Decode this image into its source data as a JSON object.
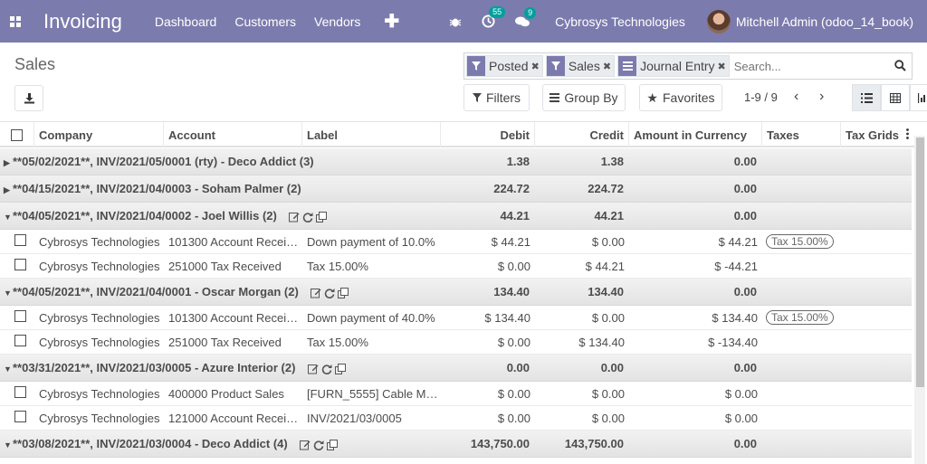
{
  "navbar": {
    "brand": "Invoicing",
    "menu": [
      "Dashboard",
      "Customers",
      "Vendors"
    ],
    "activity_count": "55",
    "message_count": "9",
    "company": "Cybrosys Technologies",
    "user": "Mitchell Admin (odoo_14_book)"
  },
  "control": {
    "breadcrumb": "Sales",
    "facets": [
      {
        "label": "Posted",
        "type": "filter"
      },
      {
        "label": "Sales",
        "type": "filter"
      },
      {
        "label": "Journal Entry",
        "type": "groupby"
      }
    ],
    "search_placeholder": "Search...",
    "filters_label": "Filters",
    "groupby_label": "Group By",
    "favorites_label": "Favorites",
    "pager": "1-9 / 9"
  },
  "table": {
    "columns": [
      "Company",
      "Account",
      "Label",
      "Debit",
      "Credit",
      "Amount in Currency",
      "Taxes",
      "Tax Grids"
    ],
    "rows": [
      {
        "kind": "group",
        "open": false,
        "label": "**05/02/2021**, INV/2021/05/0001 (rty) - Deco Addict (3)",
        "debit": "1.38",
        "credit": "1.38",
        "amount": "0.00"
      },
      {
        "kind": "group",
        "open": false,
        "label": "**04/15/2021**, INV/2021/04/0003 - Soham Palmer (2)",
        "debit": "224.72",
        "credit": "224.72",
        "amount": "0.00"
      },
      {
        "kind": "group",
        "open": true,
        "label": "**04/05/2021**, INV/2021/04/0002 - Joel Willis (2)",
        "debit": "44.21",
        "credit": "44.21",
        "amount": "0.00"
      },
      {
        "kind": "line",
        "company": "Cybrosys Technologies",
        "account": "101300 Account Recei…",
        "label": "Down payment of 10.0%",
        "debit": "$ 44.21",
        "credit": "$ 0.00",
        "amount": "$ 44.21",
        "tax": "Tax 15.00%"
      },
      {
        "kind": "line",
        "company": "Cybrosys Technologies",
        "account": "251000 Tax Received",
        "label": "Tax 15.00%",
        "debit": "$ 0.00",
        "credit": "$ 44.21",
        "amount": "$ -44.21",
        "tax": ""
      },
      {
        "kind": "group",
        "open": true,
        "label": "**04/05/2021**, INV/2021/04/0001 - Oscar Morgan (2)",
        "debit": "134.40",
        "credit": "134.40",
        "amount": "0.00"
      },
      {
        "kind": "line",
        "company": "Cybrosys Technologies",
        "account": "101300 Account Recei…",
        "label": "Down payment of 40.0%",
        "debit": "$ 134.40",
        "credit": "$ 0.00",
        "amount": "$ 134.40",
        "tax": "Tax 15.00%"
      },
      {
        "kind": "line",
        "company": "Cybrosys Technologies",
        "account": "251000 Tax Received",
        "label": "Tax 15.00%",
        "debit": "$ 0.00",
        "credit": "$ 134.40",
        "amount": "$ -134.40",
        "tax": ""
      },
      {
        "kind": "group",
        "open": true,
        "label": "**03/31/2021**, INV/2021/03/0005 - Azure Interior (2)",
        "debit": "0.00",
        "credit": "0.00",
        "amount": "0.00"
      },
      {
        "kind": "line",
        "company": "Cybrosys Technologies",
        "account": "400000 Product Sales",
        "label": "[FURN_5555] Cable M…",
        "debit": "$ 0.00",
        "credit": "$ 0.00",
        "amount": "$ 0.00",
        "tax": ""
      },
      {
        "kind": "line",
        "company": "Cybrosys Technologies",
        "account": "121000 Account Recei…",
        "label": "INV/2021/03/0005",
        "debit": "$ 0.00",
        "credit": "$ 0.00",
        "amount": "$ 0.00",
        "tax": ""
      },
      {
        "kind": "group",
        "open": true,
        "label": "**03/08/2021**, INV/2021/03/0004 - Deco Addict (4)",
        "debit": "143,750.00",
        "credit": "143,750.00",
        "amount": "0.00"
      }
    ]
  },
  "colors": {
    "navbar": "#7c7bad",
    "badge": "#00a09d"
  }
}
